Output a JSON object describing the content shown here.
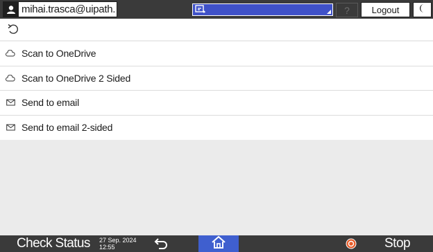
{
  "header": {
    "user": "mihai.trasca@uipath.",
    "help_label": "?",
    "logout_label": "Logout"
  },
  "list": {
    "items": [
      {
        "label": "Scan to OneDrive",
        "icon": "cloud-icon"
      },
      {
        "label": "Scan to OneDrive 2 Sided",
        "icon": "cloud-icon"
      },
      {
        "label": "Send to email",
        "icon": "envelope-icon"
      },
      {
        "label": "Send to email 2-sided",
        "icon": "envelope-icon"
      }
    ]
  },
  "footer": {
    "check_status_label": "Check Status",
    "date": "27 Sep. 2024",
    "time": "12:55",
    "stop_label": "Stop"
  },
  "colors": {
    "bar": "#3a3a3a",
    "accent": "#3f5fcf",
    "stop": "#e65c2a"
  }
}
